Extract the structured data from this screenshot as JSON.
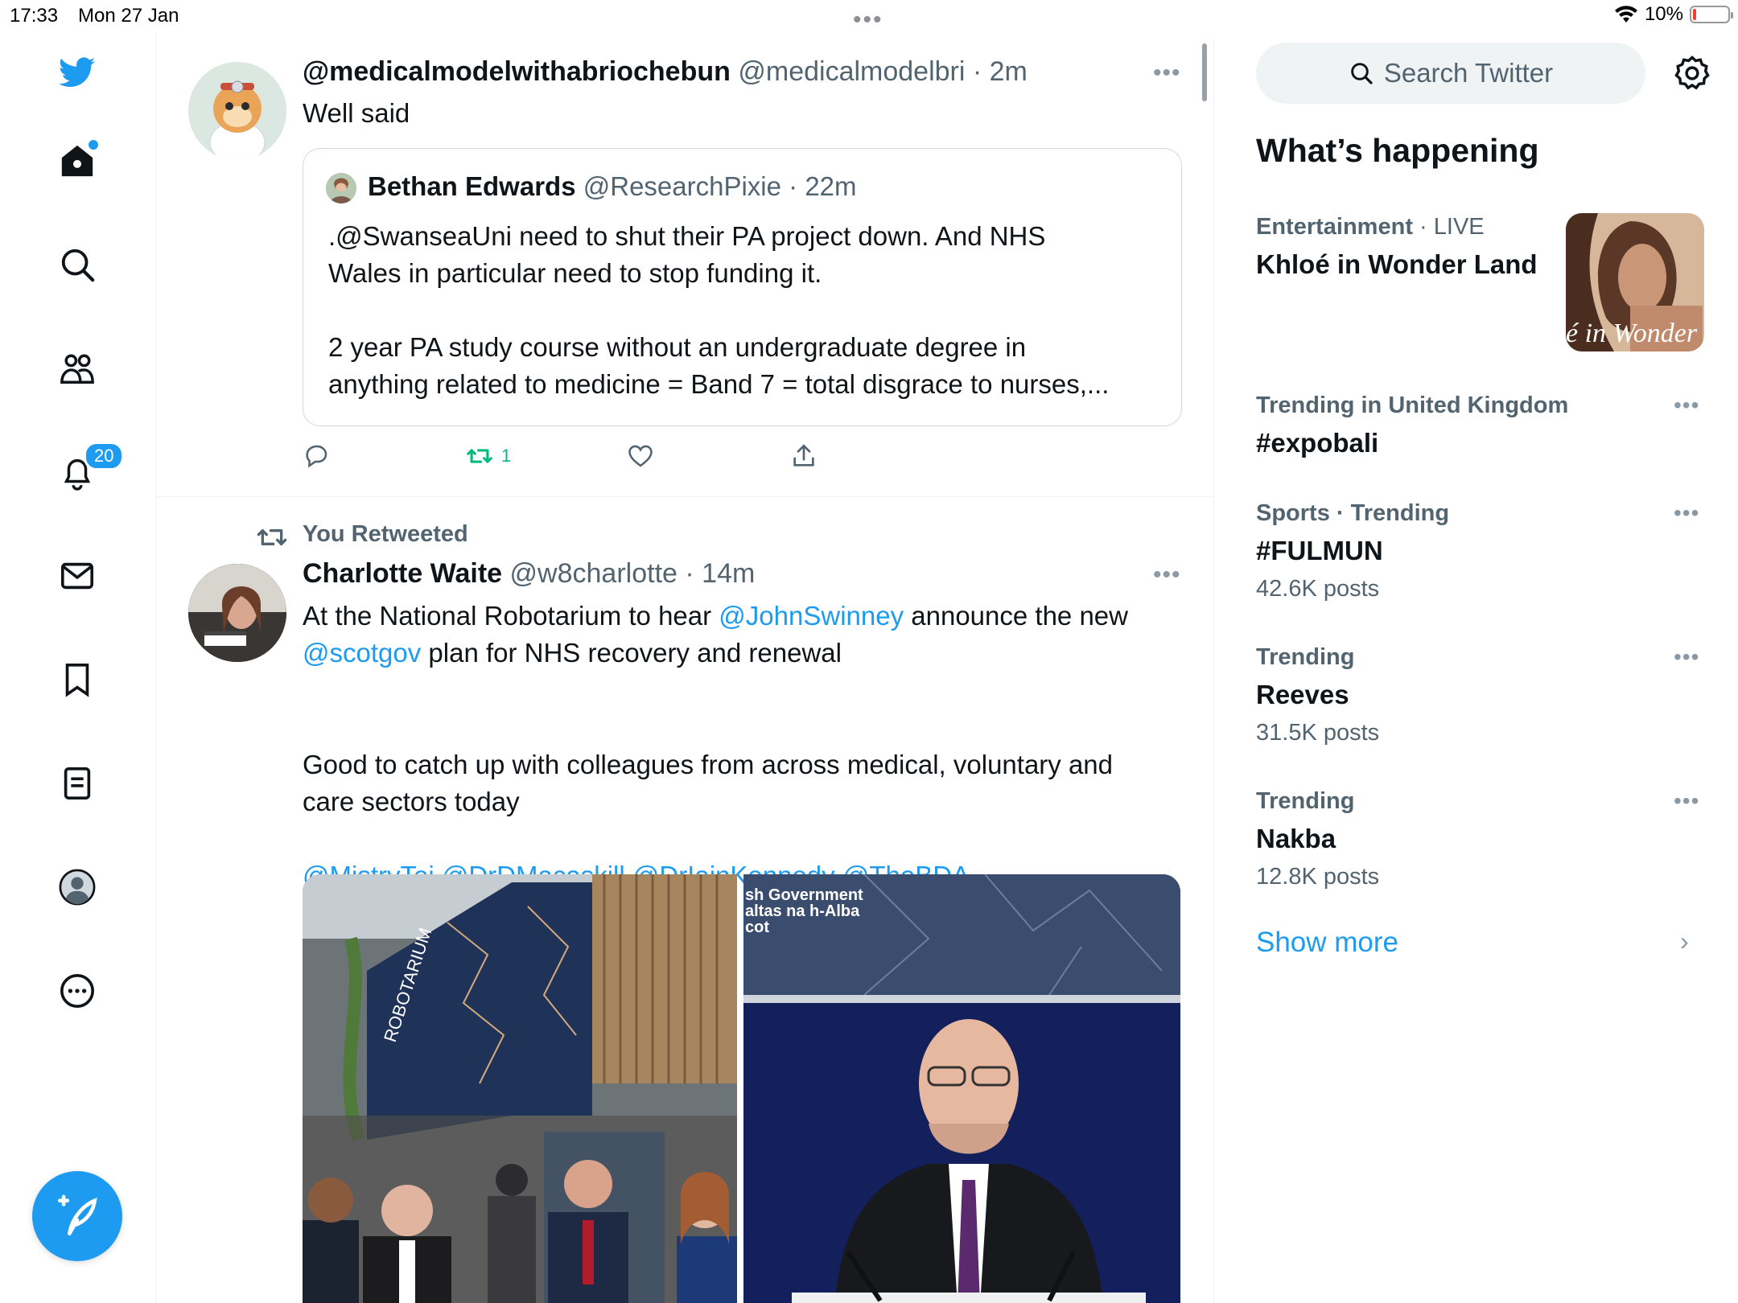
{
  "status_bar": {
    "time": "17:33",
    "date": "Mon 27 Jan",
    "battery": "10%",
    "battery_level": 0.1
  },
  "nav": {
    "notifications_badge": "20"
  },
  "tweet1": {
    "name": "@medicalmodelwithabriochebun",
    "handle": "@medicalmodelbri",
    "time": "· 2m",
    "text": "Well said",
    "quote": {
      "name": "Bethan Edwards",
      "handle": "@ResearchPixie",
      "time": "· 22m",
      "line1": ".@SwanseaUni need to shut their PA project down.  And NHS",
      "line2": "Wales in particular need to stop funding it.",
      "line3": "2 year PA study course without an undergraduate degree in",
      "line4": "anything related to medicine = Band 7 = total disgrace to nurses,..."
    },
    "retweet_count": "1"
  },
  "tweet2": {
    "retweeted_label": "You Retweeted",
    "name": "Charlotte Waite",
    "handle": "@w8charlotte",
    "time": "· 14m",
    "line1_a": "At the National Robotarium to hear ",
    "line1_link": "@JohnSwinney",
    "line1_b": " announce the new",
    "line2_link": "@scotgov",
    "line2_b": " plan for NHS recovery and renewal",
    "line3": "Good to catch up with colleagues from across medical, voluntary and",
    "line4": "care sectors today",
    "mentions": [
      "@MistryTej",
      "@DrDMacaskill",
      "@DrIainKennedy",
      "@TheBDA"
    ],
    "photo1_text": "ROBOTARIUM",
    "photo2_text1": "sh Government",
    "photo2_text2": "altas na h-Alba",
    "photo2_text3": "cot"
  },
  "right": {
    "search_placeholder": "Search Twitter",
    "whats_happening": "What’s happening",
    "trends": [
      {
        "category": "Entertainment",
        "sub": " · LIVE",
        "title": "Khloé in Wonder Land",
        "image_text": "é in Wonder L"
      },
      {
        "category": "Trending in United Kingdom",
        "title": "#expobali"
      },
      {
        "category": "Sports · Trending",
        "title": "#FULMUN",
        "count": "42.6K posts"
      },
      {
        "category": "Trending",
        "title": "Reeves",
        "count": "31.5K posts"
      },
      {
        "category": "Trending",
        "title": "Nakba",
        "count": "12.8K posts"
      }
    ],
    "show_more": "Show more"
  }
}
